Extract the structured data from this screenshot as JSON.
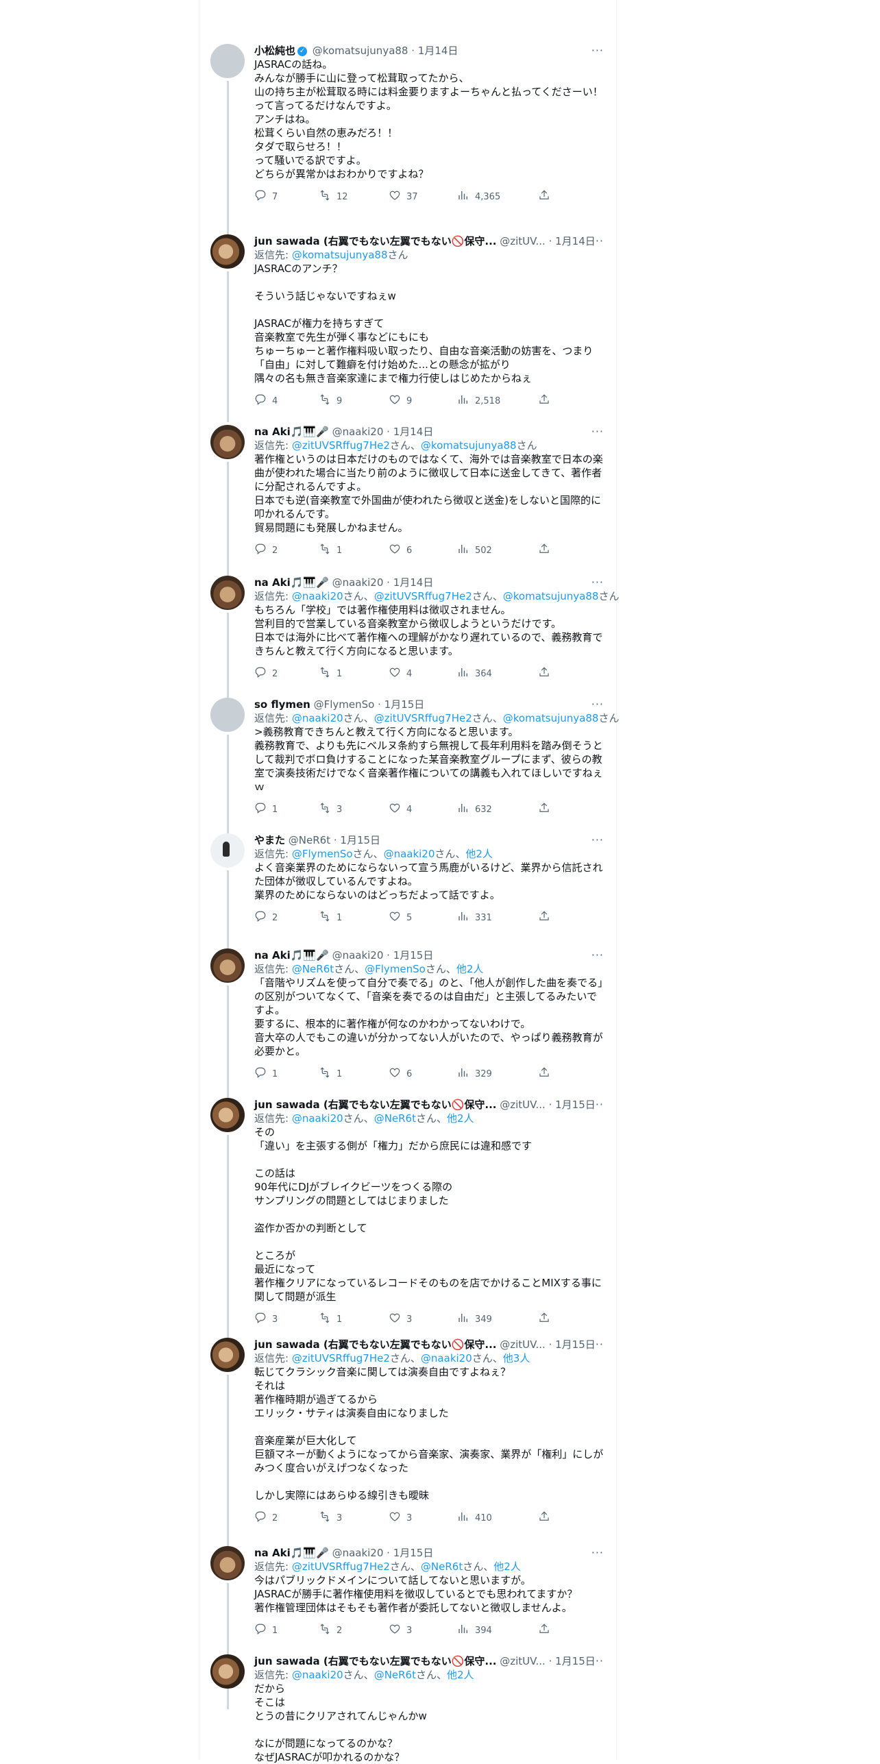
{
  "tweets": [
    {
      "name": "小松純也",
      "verified": true,
      "handle": "@komatsujunya88",
      "date": "1月14日",
      "reply_prefix": "",
      "reply_to": [],
      "reply_suffix": "",
      "text": "JASRACの話ね。\nみんなが勝手に山に登って松茸取ってたから、\n山の持ち主が松茸取る時には料金要りますよーちゃんと払ってくださーい！\nって言ってるだけなんですよ。\nアンチはね。\n松茸くらい自然の恵みだろ！！\nタダで取らせろ！！\nって騒いでる訳ですよ。\nどちらが異常かはおわかりですよね？",
      "replies": "7",
      "retweets": "12",
      "likes": "37",
      "views": "4,365",
      "avatar": "gray"
    },
    {
      "name": "jun sawada (右翼でもない左翼でもない🚫保守...",
      "verified": false,
      "handle": "@zitUV...",
      "date": "1月14日",
      "reply_prefix": "返信先: ",
      "reply_to": [
        "@komatsujunya88"
      ],
      "reply_suffix": "さん",
      "text": "JASRACのアンチ？\n\nそういう話じゃないですねぇw\n\nJASRACが権力を持ちすぎて\n音楽教室で先生が弾く事などにもにも\nちゅーちゅーと著作権料吸い取ったり、自由な音楽活動の妨害を、つまり「自由」に対して難癖を付け始めた...との懸念が拡がり\n隅々の名も無き音楽家達にまで権力行使しはじめたからねぇ",
      "replies": "4",
      "retweets": "9",
      "likes": "9",
      "views": "2,518",
      "avatar": "dogb"
    },
    {
      "name": "na Aki🎵🎹🎤",
      "verified": false,
      "handle": "@naaki20",
      "date": "1月14日",
      "reply_prefix": "返信先: ",
      "reply_to": [
        "@zitUVSRffug7He2",
        "@komatsujunya88"
      ],
      "reply_suffix": "さん",
      "text": "著作権というのは日本だけのものではなくて、海外では音楽教室で日本の楽曲が使われた場合に当たり前のように徴収して日本に送金してきて、著作者に分配されるんですよ。\n日本でも逆(音楽教室で外国曲が使われたら徴収と送金)をしないと国際的に叩かれるんです。\n貿易問題にも発展しかねません。",
      "replies": "2",
      "retweets": "1",
      "likes": "6",
      "views": "502",
      "avatar": "dog"
    },
    {
      "name": "na Aki🎵🎹🎤",
      "verified": false,
      "handle": "@naaki20",
      "date": "1月14日",
      "reply_prefix": "返信先: ",
      "reply_to": [
        "@naaki20",
        "@zitUVSRffug7He2",
        "@komatsujunya88"
      ],
      "reply_suffix": "さん",
      "text": "もちろん「学校」では著作権使用料は徴収されません。\n営利目的で営業している音楽教室から徴収しようというだけです。\n日本では海外に比べて著作権への理解がかなり遅れているので、義務教育できちんと教えて行く方向になると思います。",
      "replies": "2",
      "retweets": "1",
      "likes": "4",
      "views": "364",
      "avatar": "dog"
    },
    {
      "name": "so flymen",
      "verified": false,
      "handle": "@FlymenSo",
      "date": "1月15日",
      "reply_prefix": "返信先: ",
      "reply_to": [
        "@naaki20",
        "@zitUVSRffug7He2",
        "@komatsujunya88"
      ],
      "reply_suffix": "さん",
      "text": ">義務教育できちんと教えて行く方向になると思います。\n義務教育で、よりも先にベルヌ条約すら無視して長年利用料を踏み倒そうとして裁判でボロ負けすることになった某音楽教室グループにまず、彼らの教室で演奏技術だけでなく音楽著作権についての講義も入れてほしいですねぇｗ",
      "replies": "1",
      "retweets": "3",
      "likes": "4",
      "views": "632",
      "avatar": "gray"
    },
    {
      "name": "やまた",
      "verified": false,
      "handle": "@NeR6t",
      "date": "1月15日",
      "reply_prefix": "返信先: ",
      "reply_to": [
        "@FlymenSo",
        "@naaki20",
        "他2人"
      ],
      "reply_suffix": "",
      "text": "よく音楽業界のためにならないって宣う馬鹿がいるけど、業界から信託された団体が徴収しているんですよね。\n業界のためにならないのはどっちだよって話ですよ。",
      "replies": "2",
      "retweets": "1",
      "likes": "5",
      "views": "331",
      "avatar": "yamata"
    },
    {
      "name": "na Aki🎵🎹🎤",
      "verified": false,
      "handle": "@naaki20",
      "date": "1月15日",
      "reply_prefix": "返信先: ",
      "reply_to": [
        "@NeR6t",
        "@FlymenSo",
        "他2人"
      ],
      "reply_suffix": "",
      "text": "「音階やリズムを使って自分で奏でる」のと、「他人が創作した曲を奏でる」の区別がついてなくて、「音楽を奏でるのは自由だ」と主張してるみたいですよ。\n要するに、根本的に著作権が何なのかわかってないわけで。\n音大卒の人でもこの違いが分かってない人がいたので、やっぱり義務教育が必要かと。",
      "replies": "1",
      "retweets": "1",
      "likes": "6",
      "views": "329",
      "avatar": "dog"
    },
    {
      "name": "jun sawada (右翼でもない左翼でもない🚫保守...",
      "verified": false,
      "handle": "@zitUV...",
      "date": "1月15日",
      "reply_prefix": "返信先: ",
      "reply_to": [
        "@naaki20",
        "@NeR6t",
        "他2人"
      ],
      "reply_suffix": "",
      "text": "その\n「違い」を主張する側が「権力」だから庶民には違和感です\n\nこの話は\n90年代にDJがブレイクビーツをつくる際の\nサンプリングの問題としてはじまりました\n\n盗作か否かの判断として\n\nところが\n最近になって\n著作権クリアになっているレコードそのものを店でかけることMIXする事に関して問題が派生",
      "replies": "3",
      "retweets": "1",
      "likes": "3",
      "views": "349",
      "avatar": "dogb"
    },
    {
      "name": "jun sawada (右翼でもない左翼でもない🚫保守...",
      "verified": false,
      "handle": "@zitUV...",
      "date": "1月15日",
      "reply_prefix": "返信先: ",
      "reply_to": [
        "@zitUVSRffug7He2",
        "@naaki20",
        "他3人"
      ],
      "reply_suffix": "",
      "text": "転じてクラシック音楽に関しては演奏自由ですよねぇ？\nそれは\n著作権時期が過ぎてるから\nエリック・サティは演奏自由になりました\n\n音楽産業が巨大化して\n巨額マネーが動くようになってから音楽家、演奏家、業界が「権利」にしがみつく度合いがえげつなくなった\n\nしかし実際にはあらゆる線引きも曖昧",
      "replies": "2",
      "retweets": "3",
      "likes": "3",
      "views": "410",
      "avatar": "dogb"
    },
    {
      "name": "na Aki🎵🎹🎤",
      "verified": false,
      "handle": "@naaki20",
      "date": "1月15日",
      "reply_prefix": "返信先: ",
      "reply_to": [
        "@zitUVSRffug7He2",
        "@NeR6t",
        "他2人"
      ],
      "reply_suffix": "",
      "text": "今はパブリックドメインについて話してないと思いますが。\nJASRACが勝手に著作権使用料を徴収しているとでも思われてますか？\n著作権管理団体はそもそも著作者が委託してないと徴収しませんよ。",
      "replies": "1",
      "retweets": "2",
      "likes": "3",
      "views": "394",
      "avatar": "dog"
    },
    {
      "name": "jun sawada (右翼でもない左翼でもない🚫保守...",
      "verified": false,
      "handle": "@zitUV...",
      "date": "1月15日",
      "reply_prefix": "返信先: ",
      "reply_to": [
        "@naaki20",
        "@NeR6t",
        "他2人"
      ],
      "reply_suffix": "",
      "text": "だから\nそこは\nとうの昔にクリアされてんじゃんかw\n\nなにが問題になってるのかな？\nなぜJASRACが叩かれるのかな？",
      "replies": "",
      "retweets": "",
      "likes": "",
      "views": "",
      "avatar": "dogb"
    }
  ]
}
